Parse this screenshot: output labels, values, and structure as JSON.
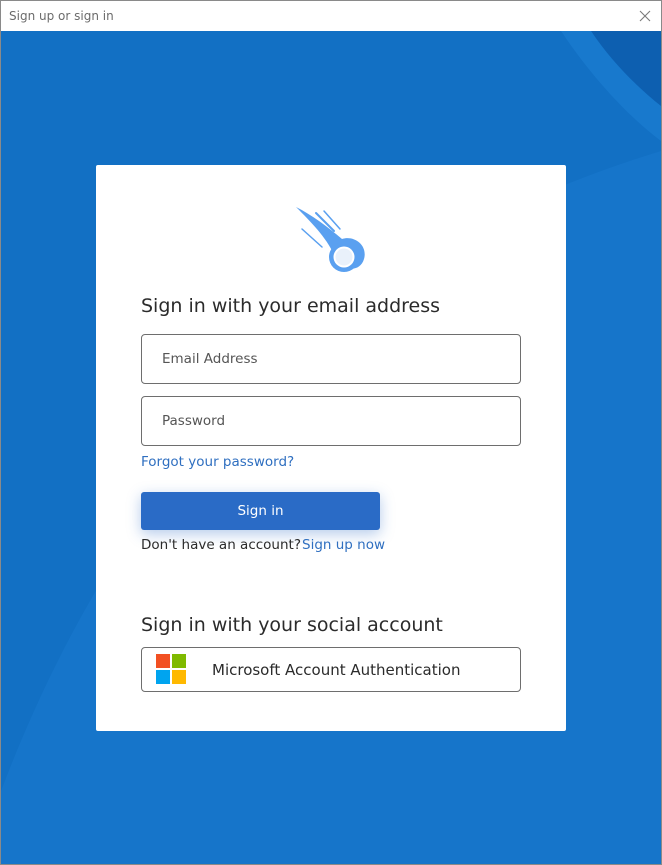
{
  "window": {
    "title": "Sign up or sign in",
    "close_icon": "close-icon"
  },
  "colors": {
    "background": "#1270c4",
    "primary_button": "#2a6bc6",
    "link": "#2f6fc0",
    "logo": "#5aa0f0"
  },
  "card": {
    "logo_icon": "comet-logo-icon",
    "email_heading": "Sign in with your email address",
    "email_placeholder": "Email Address",
    "password_placeholder": "Password",
    "forgot_password": "Forgot your password?",
    "signin_button": "Sign in",
    "no_account_text": "Don't have an account?",
    "signup_link": "Sign up now",
    "social_heading": "Sign in with your social account",
    "social_button": {
      "icon": "microsoft-logo-icon",
      "label": "Microsoft Account Authentication",
      "icon_colors": [
        "#f25022",
        "#7fba00",
        "#00a4ef",
        "#ffb900"
      ]
    }
  }
}
